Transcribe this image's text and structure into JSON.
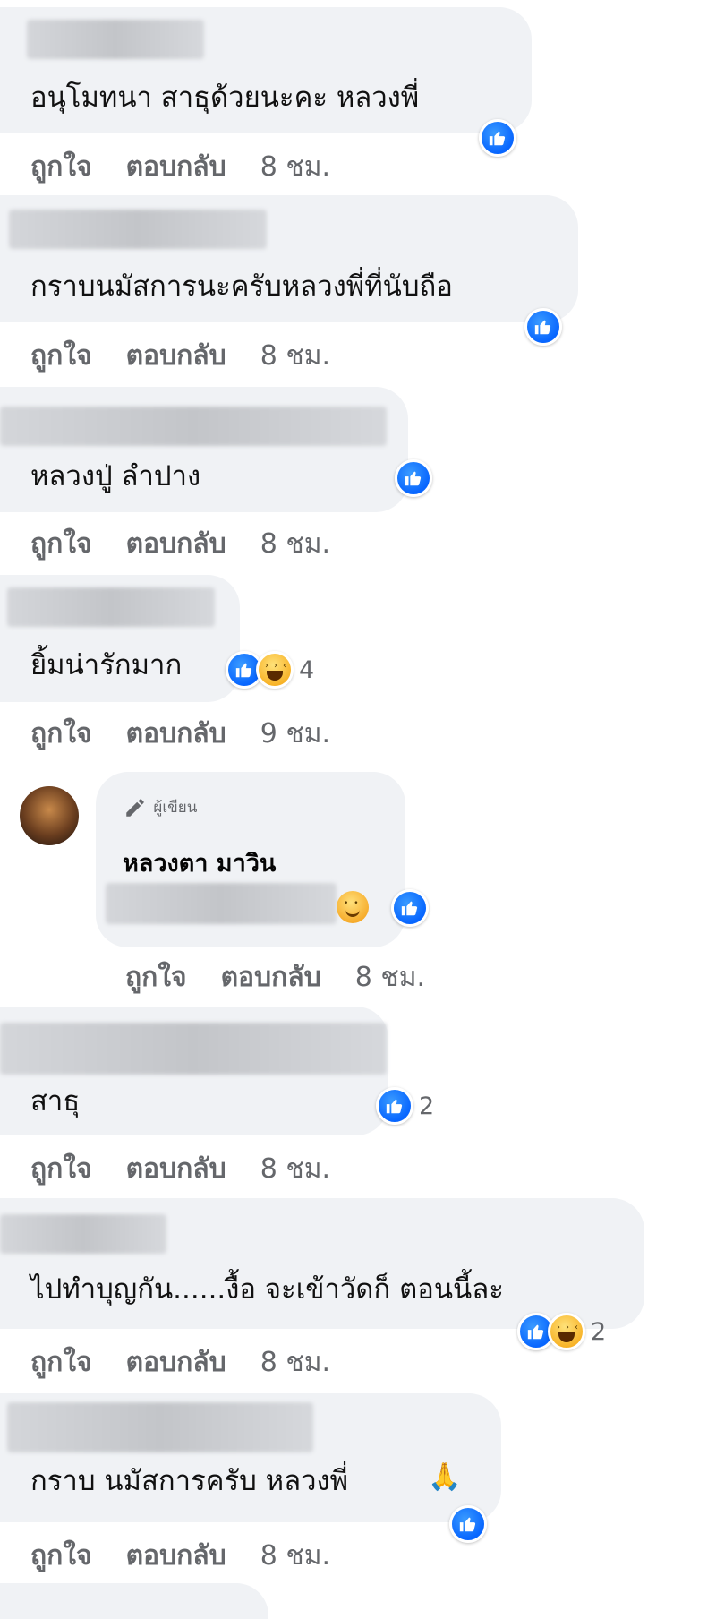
{
  "actions": {
    "like": "ถูกใจ",
    "reply": "ตอบกลับ"
  },
  "comments": [
    {
      "text": "อนุโมทนา สาธุด้วยนะคะ หลวงพี่",
      "time": "8 ชม.",
      "reactions": [
        "like"
      ],
      "count": ""
    },
    {
      "text": "กราบนมัสการนะครับหลวงพี่ที่นับถือ",
      "time": "8 ชม.",
      "reactions": [
        "like"
      ],
      "count": ""
    },
    {
      "text": "หลวงปู่ ลำปาง",
      "time": "8 ชม.",
      "reactions": [
        "like"
      ],
      "count": ""
    },
    {
      "text": "ยิ้มน่ารักมาก",
      "time": "9 ชม.",
      "reactions": [
        "like",
        "haha"
      ],
      "count": "4"
    },
    {
      "text": "สาธุ",
      "time": "8 ชม.",
      "reactions": [
        "like"
      ],
      "count": "2"
    },
    {
      "text": "ไปทำบุญกัน......งื้อ จะเข้าวัดก็ ตอนนี้ละ",
      "time": "8 ชม.",
      "reactions": [
        "like",
        "haha"
      ],
      "count": "2"
    },
    {
      "text": "กราบ นมัสการครับ หลวงพี่",
      "time": "8 ชม.",
      "reactions": [
        "like"
      ],
      "count": ""
    }
  ],
  "reply": {
    "badge": "ผู้เขียน",
    "author": "หลวงตา มาวิน",
    "time": "8 ชม.",
    "emoji": "smiling-face"
  },
  "colors": {
    "bubble": "#f0f2f5",
    "like": "#0866ff",
    "meta": "#65676b"
  }
}
